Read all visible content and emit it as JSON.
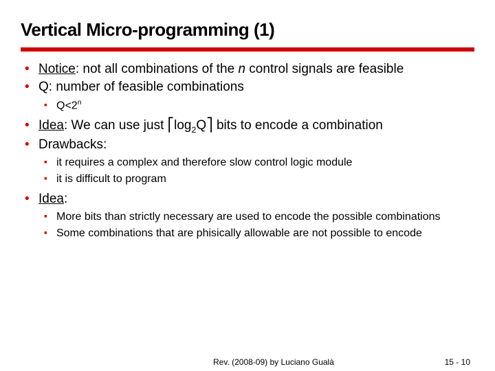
{
  "title": "Vertical Micro-programming (1)",
  "bullets": {
    "b1a": "Notice",
    "b1b": ": not all combinations of the ",
    "b1c": "n",
    "b1d": " control signals are feasible",
    "b2": "Q: number of feasible combinations",
    "b2s1a": "Q<2",
    "b2s1b": "n",
    "b3a": "Idea",
    "b3b": ": We can use just ⎡log",
    "b3c": "2",
    "b3d": "Q⎤ bits to encode a combination",
    "b4": "Drawbacks:",
    "b4s1": "it requires a complex and therefore slow control logic module",
    "b4s2": "it is difficult to program",
    "b5a": "Idea",
    "b5b": ":",
    "b5s1": "More bits than strictly necessary are used to encode the possible combinations",
    "b5s2": "Some combinations that are phisically allowable are not possible to encode"
  },
  "footer": {
    "rev": "Rev. (2008-09) by Luciano Gualà",
    "page_prefix": "15 - ",
    "page_num": "10"
  }
}
